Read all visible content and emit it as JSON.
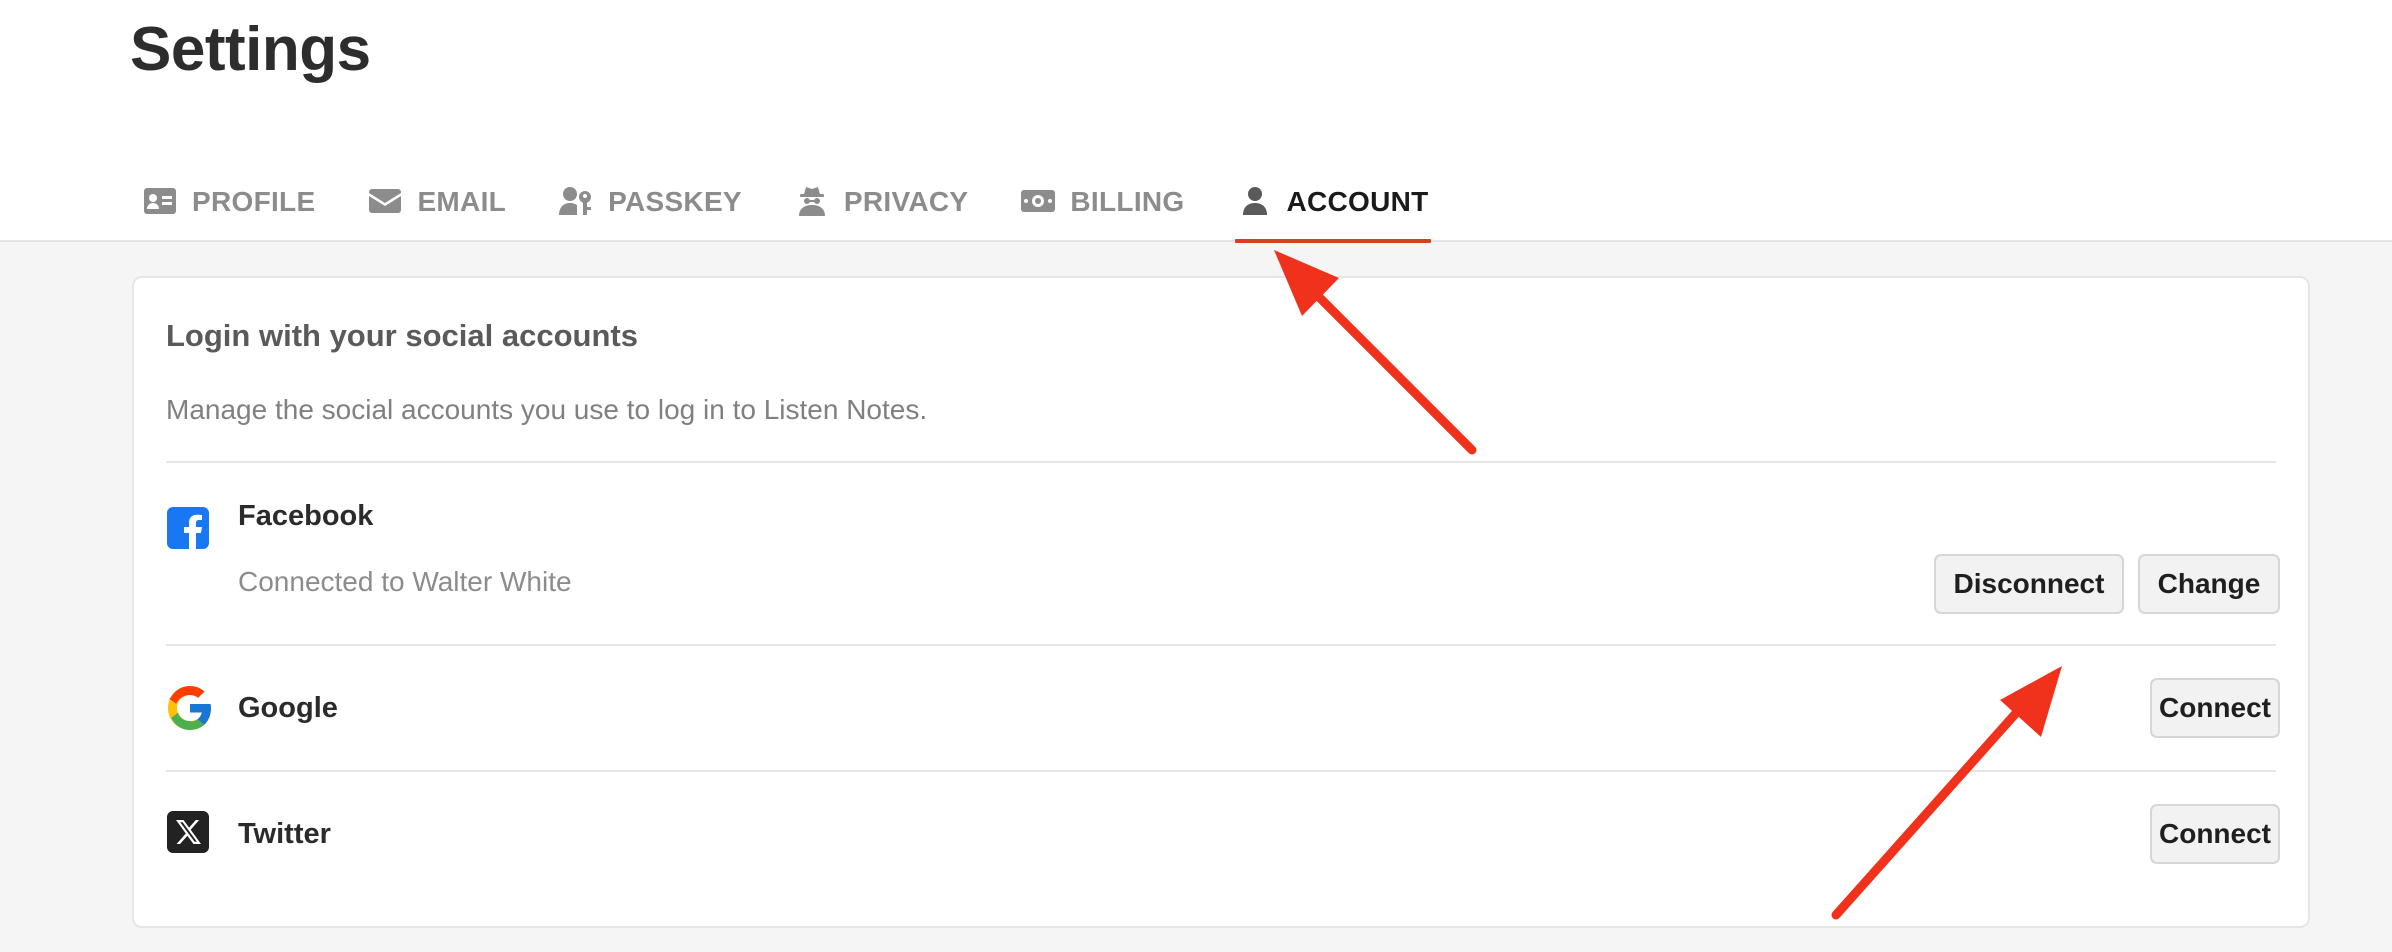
{
  "page": {
    "title": "Settings"
  },
  "tabs": [
    {
      "label": "PROFILE",
      "icon": "id-card-icon",
      "active": false
    },
    {
      "label": "EMAIL",
      "icon": "envelope-icon",
      "active": false
    },
    {
      "label": "PASSKEY",
      "icon": "user-key-icon",
      "active": false
    },
    {
      "label": "PRIVACY",
      "icon": "user-secret-icon",
      "active": false
    },
    {
      "label": "BILLING",
      "icon": "money-bill-icon",
      "active": false
    },
    {
      "label": "ACCOUNT",
      "icon": "user-icon",
      "active": true
    }
  ],
  "social": {
    "title": "Login with your social accounts",
    "description": "Manage the social accounts you use to log in to Listen Notes.",
    "accounts": [
      {
        "name": "Facebook",
        "icon": "facebook-icon",
        "status": "Connected to Walter White",
        "buttons": [
          "Disconnect",
          "Change"
        ]
      },
      {
        "name": "Google",
        "icon": "google-icon",
        "buttons": [
          "Connect"
        ]
      },
      {
        "name": "Twitter",
        "icon": "x-twitter-icon",
        "buttons": [
          "Connect"
        ]
      }
    ]
  },
  "colors": {
    "accent": "#d8401f",
    "annotation_arrow": "#f0321c",
    "facebook": "#1877f2"
  }
}
